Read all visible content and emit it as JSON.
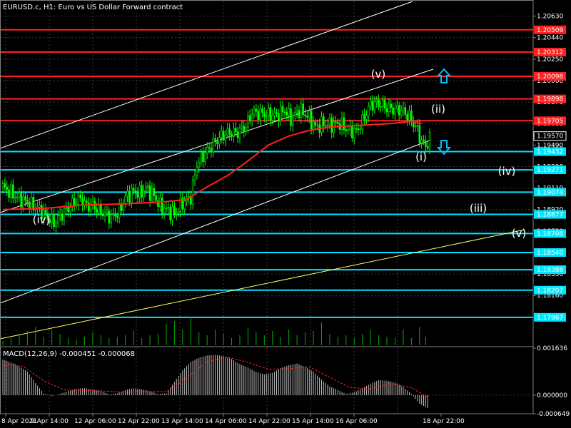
{
  "chart_data": {
    "type": "candlestick",
    "title": "EURUSD.c, H1:  Euro vs US Dollar Forward contract",
    "ylim": [
      1.1772,
      1.2076
    ],
    "price_ticks": [
      "1.20630",
      "1.20440",
      "1.20250",
      "1.20060",
      "1.19870",
      "1.19680",
      "1.19490",
      "1.19300",
      "1.19110",
      "1.18920",
      "1.18730",
      "1.18540",
      "1.18350",
      "1.18160"
    ],
    "resistance_levels": [
      {
        "label": "1.20509",
        "value": 1.20509
      },
      {
        "label": "1.20312",
        "value": 1.20312
      },
      {
        "label": "1.20098",
        "value": 1.20098
      },
      {
        "label": "1.19898",
        "value": 1.19898
      },
      {
        "label": "1.19705",
        "value": 1.19705
      }
    ],
    "support_levels": [
      {
        "label": "1.19432",
        "value": 1.19432
      },
      {
        "label": "1.19271",
        "value": 1.19271
      },
      {
        "label": "1.19074",
        "value": 1.19074
      },
      {
        "label": "1.18877",
        "value": 1.18877
      },
      {
        "label": "1.18708",
        "value": 1.18708
      },
      {
        "label": "1.18540",
        "value": 1.1854
      },
      {
        "label": "1.18388",
        "value": 1.18388
      },
      {
        "label": "1.18207",
        "value": 1.18207
      },
      {
        "label": "1.17967",
        "value": 1.17967
      }
    ],
    "current_price": {
      "label": "1.19570",
      "value": 1.1957
    },
    "x_labels": [
      "8 Apr 2021",
      "9 Apr 14:00",
      "12 Apr 06:00",
      "12 Apr 22:00",
      "13 Apr 14:00",
      "14 Apr 06:00",
      "14 Apr 22:00",
      "15 Apr 14:00",
      "16 Apr 06:00",
      "18 Apr 22:00"
    ],
    "close_path": [
      [
        0,
        1.1912
      ],
      [
        6,
        1.1904
      ],
      [
        12,
        1.1898
      ],
      [
        18,
        1.1892
      ],
      [
        22,
        1.1885
      ],
      [
        25,
        1.188
      ],
      [
        29,
        1.1888
      ],
      [
        34,
        1.1897
      ],
      [
        38,
        1.1902
      ],
      [
        41,
        1.1895
      ],
      [
        44,
        1.1896
      ],
      [
        48,
        1.189
      ],
      [
        53,
        1.1885
      ],
      [
        57,
        1.189
      ],
      [
        60,
        1.1903
      ],
      [
        64,
        1.1908
      ],
      [
        67,
        1.1906
      ],
      [
        70,
        1.1911
      ],
      [
        74,
        1.1904
      ],
      [
        77,
        1.1895
      ],
      [
        80,
        1.1892
      ],
      [
        84,
        1.1888
      ],
      [
        88,
        1.1898
      ],
      [
        92,
        1.1903
      ],
      [
        95,
        1.1932
      ],
      [
        99,
        1.1942
      ],
      [
        103,
        1.195
      ],
      [
        107,
        1.1957
      ],
      [
        111,
        1.196
      ],
      [
        115,
        1.196
      ],
      [
        119,
        1.1966
      ],
      [
        122,
        1.1978
      ],
      [
        126,
        1.1977
      ],
      [
        130,
        1.1976
      ],
      [
        134,
        1.1975
      ],
      [
        138,
        1.198
      ],
      [
        141,
        1.1972
      ],
      [
        145,
        1.198
      ],
      [
        149,
        1.1975
      ],
      [
        153,
        1.1965
      ],
      [
        157,
        1.1968
      ],
      [
        161,
        1.1967
      ],
      [
        165,
        1.1968
      ],
      [
        169,
        1.1962
      ],
      [
        173,
        1.1961
      ],
      [
        176,
        1.197
      ],
      [
        180,
        1.1985
      ],
      [
        184,
        1.1986
      ],
      [
        188,
        1.1982
      ],
      [
        192,
        1.198
      ],
      [
        195,
        1.198
      ],
      [
        199,
        1.1974
      ],
      [
        203,
        1.1962
      ],
      [
        205,
        1.1952
      ],
      [
        207,
        1.1948
      ],
      [
        209,
        1.1954
      ]
    ],
    "ma_path": [
      [
        0,
        1.1892
      ],
      [
        20,
        1.1893
      ],
      [
        40,
        1.1896
      ],
      [
        60,
        1.1897
      ],
      [
        70,
        1.1898
      ],
      [
        80,
        1.1899
      ],
      [
        90,
        1.1901
      ],
      [
        100,
        1.1912
      ],
      [
        110,
        1.1922
      ],
      [
        120,
        1.1935
      ],
      [
        130,
        1.1949
      ],
      [
        140,
        1.1957
      ],
      [
        150,
        1.1962
      ],
      [
        160,
        1.1965
      ],
      [
        170,
        1.1966
      ],
      [
        180,
        1.1967
      ],
      [
        190,
        1.1968
      ],
      [
        200,
        1.197
      ],
      [
        205,
        1.1968
      ]
    ],
    "volume": [
      [
        0,
        6
      ],
      [
        4,
        10
      ],
      [
        8,
        14
      ],
      [
        12,
        20
      ],
      [
        16,
        26
      ],
      [
        20,
        12
      ],
      [
        24,
        22
      ],
      [
        28,
        16
      ],
      [
        32,
        10
      ],
      [
        36,
        8
      ],
      [
        40,
        12
      ],
      [
        44,
        18
      ],
      [
        48,
        14
      ],
      [
        52,
        10
      ],
      [
        56,
        12
      ],
      [
        60,
        14
      ],
      [
        64,
        20
      ],
      [
        68,
        10
      ],
      [
        72,
        14
      ],
      [
        76,
        16
      ],
      [
        80,
        30
      ],
      [
        84,
        34
      ],
      [
        88,
        22
      ],
      [
        92,
        40
      ],
      [
        96,
        18
      ],
      [
        100,
        14
      ],
      [
        104,
        22
      ],
      [
        108,
        16
      ],
      [
        112,
        10
      ],
      [
        116,
        14
      ],
      [
        120,
        24
      ],
      [
        124,
        18
      ],
      [
        128,
        14
      ],
      [
        132,
        20
      ],
      [
        136,
        12
      ],
      [
        140,
        22
      ],
      [
        144,
        14
      ],
      [
        148,
        18
      ],
      [
        152,
        20
      ],
      [
        156,
        32
      ],
      [
        160,
        16
      ],
      [
        164,
        12
      ],
      [
        168,
        14
      ],
      [
        172,
        10
      ],
      [
        176,
        16
      ],
      [
        180,
        22
      ],
      [
        184,
        14
      ],
      [
        188,
        12
      ],
      [
        192,
        10
      ],
      [
        196,
        22
      ],
      [
        200,
        10
      ],
      [
        204,
        26
      ],
      [
        207,
        12
      ]
    ],
    "macd": {
      "label": "MACD(12,26,9) -0.000451 -0.000068",
      "ylim": [
        -0.000649,
        0.001636
      ],
      "ticks": [
        "0.001636",
        "0.000000",
        "-0.000649"
      ],
      "hist": [
        [
          0,
          0.00124
        ],
        [
          6,
          0.00108
        ],
        [
          12,
          0.00082
        ],
        [
          16,
          0.00042
        ],
        [
          20,
          6e-05
        ],
        [
          24,
          -4e-05
        ],
        [
          28,
          4e-05
        ],
        [
          32,
          0.00014
        ],
        [
          36,
          0.00022
        ],
        [
          40,
          0.00024
        ],
        [
          44,
          0.0002
        ],
        [
          48,
          0.00014
        ],
        [
          52,
          2e-05
        ],
        [
          56,
          6e-05
        ],
        [
          60,
          0.00018
        ],
        [
          64,
          0.00024
        ],
        [
          68,
          0.0002
        ],
        [
          72,
          0.00014
        ],
        [
          76,
          4e-05
        ],
        [
          80,
          6e-05
        ],
        [
          84,
          0.00046
        ],
        [
          88,
          0.00086
        ],
        [
          92,
          0.00116
        ],
        [
          96,
          0.0013
        ],
        [
          100,
          0.00138
        ],
        [
          104,
          0.0014
        ],
        [
          108,
          0.00136
        ],
        [
          112,
          0.00126
        ],
        [
          116,
          0.00108
        ],
        [
          120,
          0.00096
        ],
        [
          124,
          0.0008
        ],
        [
          128,
          0.00072
        ],
        [
          132,
          0.00078
        ],
        [
          136,
          0.00094
        ],
        [
          140,
          0.00104
        ],
        [
          144,
          0.0011
        ],
        [
          148,
          0.00098
        ],
        [
          152,
          0.00082
        ],
        [
          156,
          0.00054
        ],
        [
          160,
          0.0003
        ],
        [
          164,
          0.00018
        ],
        [
          168,
          4e-05
        ],
        [
          172,
          0.0001
        ],
        [
          176,
          0.00024
        ],
        [
          180,
          0.0004
        ],
        [
          184,
          0.00052
        ],
        [
          188,
          0.0005
        ],
        [
          192,
          0.00044
        ],
        [
          196,
          0.00028
        ],
        [
          200,
          4e-05
        ],
        [
          204,
          -0.0003
        ],
        [
          208,
          -0.00045
        ]
      ],
      "signal": [
        [
          0,
          0.00108
        ],
        [
          10,
          0.001
        ],
        [
          20,
          0.0005
        ],
        [
          30,
          0.00018
        ],
        [
          40,
          0.00016
        ],
        [
          50,
          0.00014
        ],
        [
          60,
          0.0001
        ],
        [
          70,
          0.00012
        ],
        [
          80,
          0.00012
        ],
        [
          90,
          0.0006
        ],
        [
          100,
          0.00116
        ],
        [
          110,
          0.00132
        ],
        [
          120,
          0.00114
        ],
        [
          130,
          0.0009
        ],
        [
          140,
          0.00092
        ],
        [
          150,
          0.00098
        ],
        [
          160,
          0.00062
        ],
        [
          170,
          0.00026
        ],
        [
          180,
          0.00022
        ],
        [
          190,
          0.0004
        ],
        [
          200,
          0.00026
        ],
        [
          208,
          -7e-05
        ]
      ]
    },
    "annotations": [
      {
        "text": "(iv)",
        "role": "wave-iv-past"
      },
      {
        "text": "(v)",
        "role": "wave-v-top"
      },
      {
        "text": "(ii)",
        "role": "wave-ii"
      },
      {
        "text": "(i)",
        "role": "wave-i"
      },
      {
        "text": "(iv)",
        "role": "wave-iv-target"
      },
      {
        "text": "(iii)",
        "role": "wave-iii-target"
      },
      {
        "text": "(v)",
        "role": "wave-v-target"
      }
    ],
    "colors": {
      "background": "#000000",
      "candles": "#00ff00",
      "volume": "#00b000",
      "moving_average": "#ff2020",
      "resistance": "#ff2020",
      "support": "#00e5ff",
      "channel": "#ffffff",
      "trend_line": "#ffff66",
      "arrow": "#00bfff",
      "macd_hist": "#c0c0c0",
      "macd_signal": "#ff2020"
    }
  }
}
